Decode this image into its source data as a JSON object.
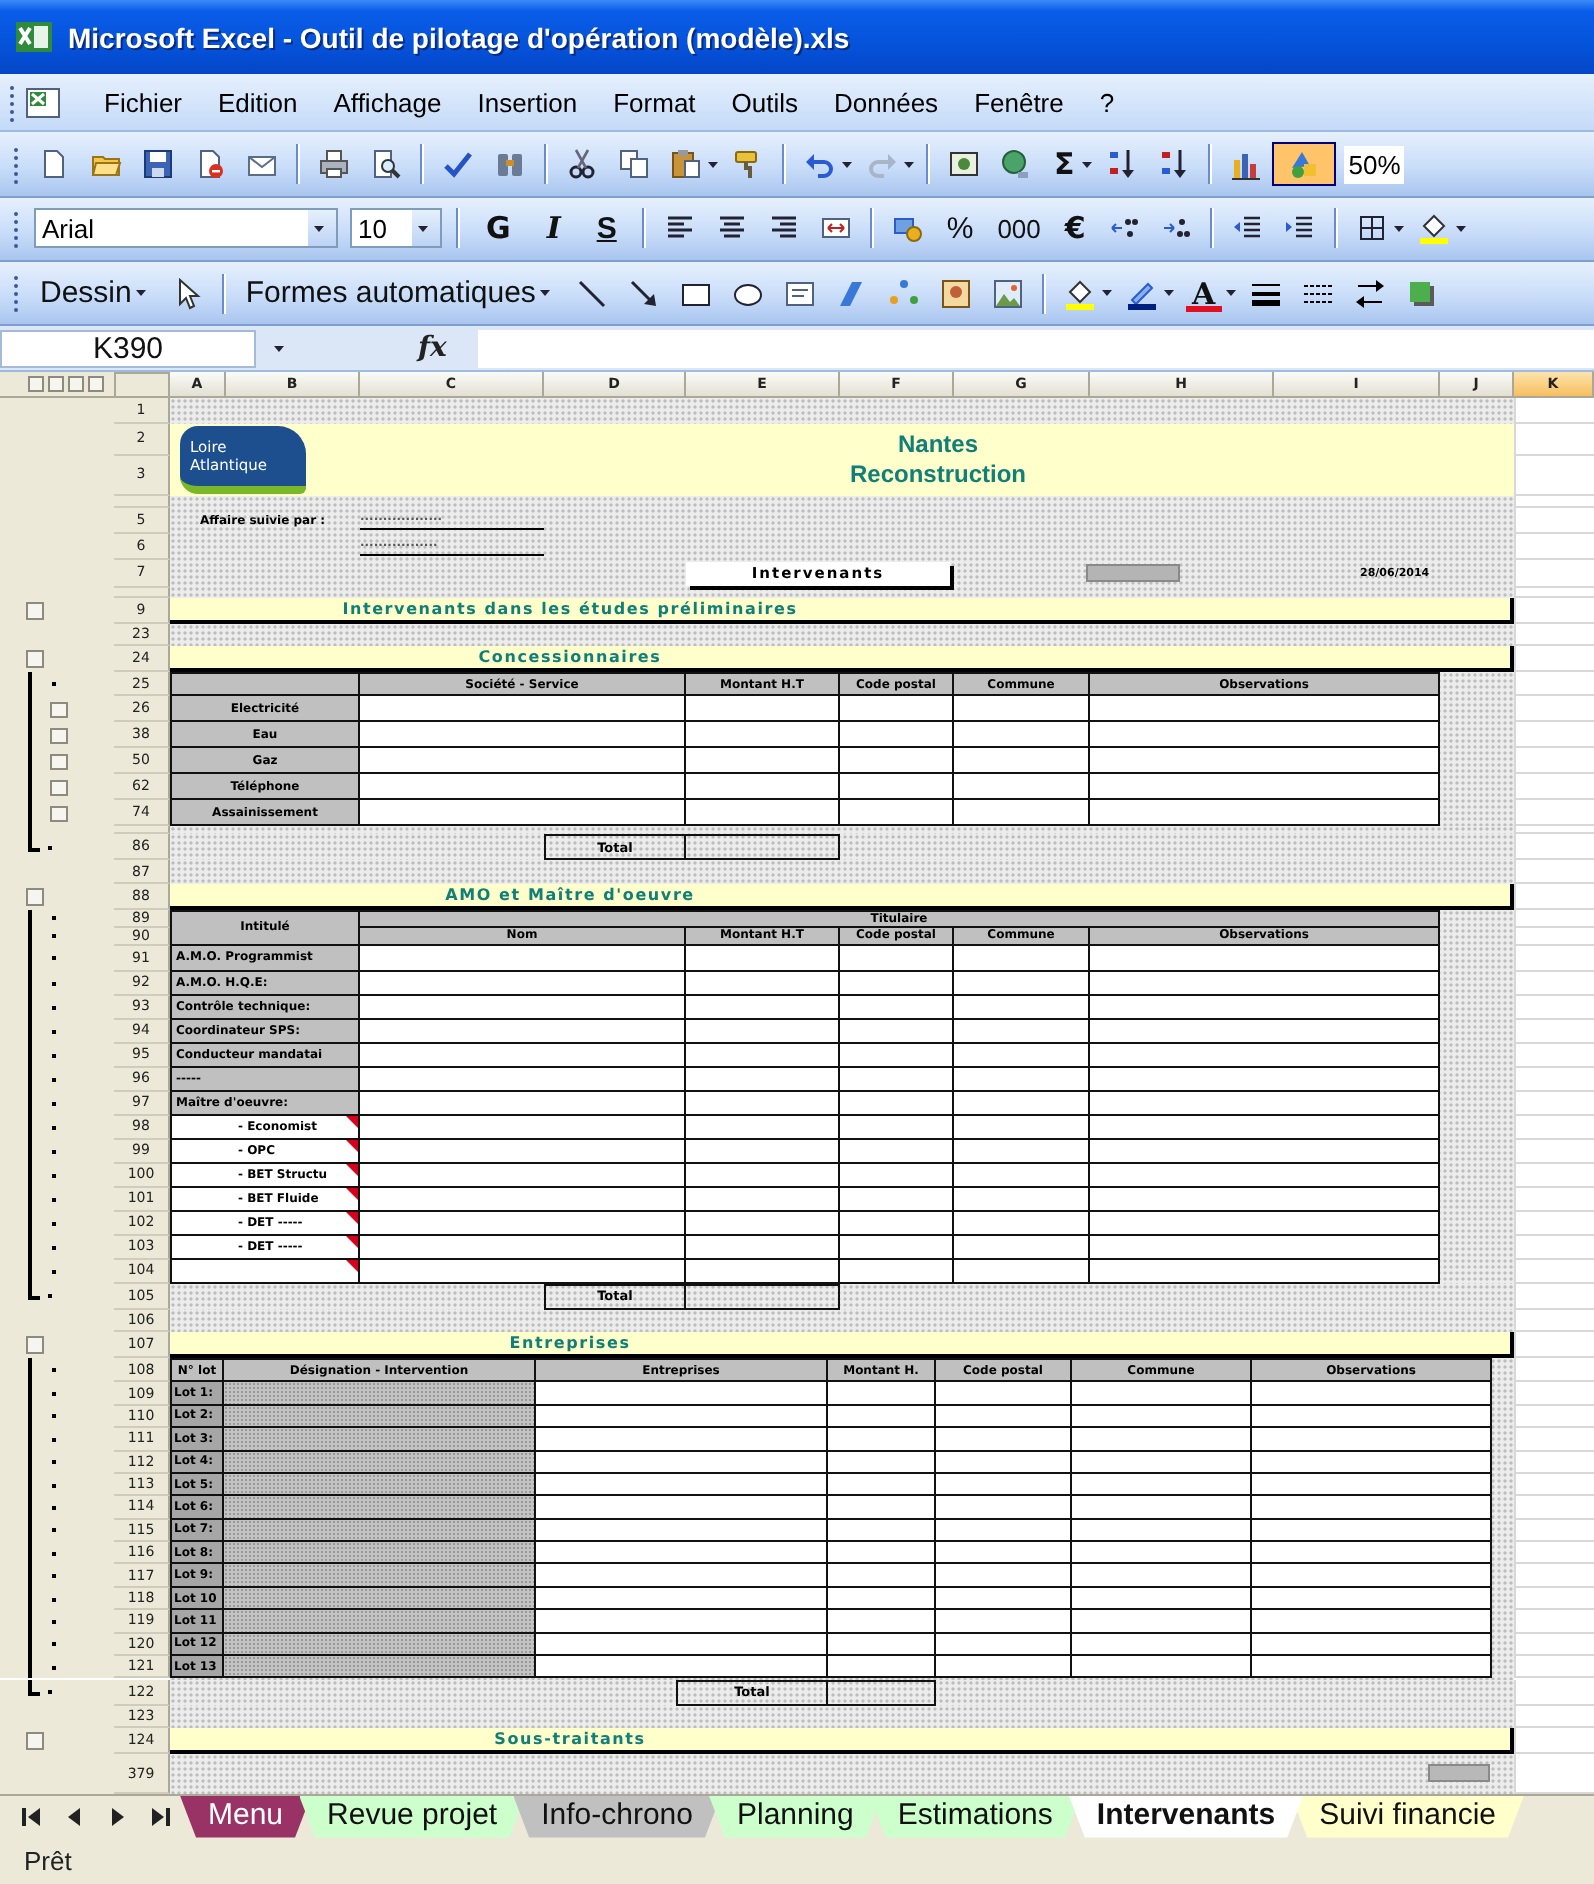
{
  "window": {
    "title": "Microsoft Excel - Outil de pilotage d'opération (modèle).xls"
  },
  "menu": [
    "Fichier",
    "Edition",
    "Affichage",
    "Insertion",
    "Format",
    "Outils",
    "Données",
    "Fenêtre",
    "?"
  ],
  "standard_toolbar": {
    "sum": "Σ",
    "drawing_on": true,
    "zoom": "50%"
  },
  "formatting_toolbar": {
    "font": "Arial",
    "size": "10",
    "bold": "G",
    "italic": "I",
    "underline": "S",
    "percent": "%",
    "thousands": "000",
    "euro": "€"
  },
  "drawing_toolbar": {
    "draw_menu": "Dessin",
    "autoshapes": "Formes automatiques",
    "font_color": "A"
  },
  "formula_bar": {
    "name_box": "K390",
    "function_label": "fx"
  },
  "sheet": {
    "columns": [
      {
        "label": "A",
        "selected": false
      },
      {
        "label": "B",
        "selected": false
      },
      {
        "label": "C",
        "selected": false
      },
      {
        "label": "D",
        "selected": false
      },
      {
        "label": "E",
        "selected": false
      },
      {
        "label": "F",
        "selected": false
      },
      {
        "label": "G",
        "selected": false
      },
      {
        "label": "H",
        "selected": false
      },
      {
        "label": "I",
        "selected": false
      },
      {
        "label": "J",
        "selected": false
      },
      {
        "label": "K",
        "selected": true
      }
    ],
    "bands": [
      {
        "kind": "banner",
        "rows": [
          {
            "number": "1",
            "kind": "plain"
          },
          {
            "number": "2",
            "kind": "plain"
          },
          {
            "number": "3",
            "kind": "plain"
          }
        ],
        "logo": [
          "Loire",
          "Atlantique"
        ],
        "title": "Nantes",
        "subtitle": "Reconstruction"
      },
      {
        "kind": "info",
        "rows": [
          {
            "kind": "plain"
          },
          {
            "number": "5",
            "kind": "plain"
          },
          {
            "number": "6",
            "kind": "plain"
          },
          {
            "number": "7",
            "kind": "plain"
          },
          {
            "kind": "plain"
          }
        ],
        "label": "Affaire suivie par :",
        "followers": [
          "..................",
          "................."
        ],
        "button": "Intervenants",
        "date": "28/06/2014"
      },
      {
        "kind": "section",
        "rows": [
          {
            "number": "9",
            "kind": "button"
          }
        ],
        "title": "Intervenants dans les études préliminaires"
      },
      {
        "kind": "blank",
        "rows": [
          {
            "number": "23",
            "kind": "plain"
          }
        ]
      },
      {
        "kind": "section",
        "rows": [
          {
            "number": "24",
            "kind": "button"
          }
        ],
        "title": "Concessionnaires"
      },
      {
        "kind": "utility_table",
        "header_rows": [
          {
            "number": "25",
            "kind": "dot"
          }
        ],
        "columns": [
          "Société - Service",
          "Montant H.T",
          "Code postal",
          "Commune",
          "Observations"
        ],
        "rows": [
          {
            "number": "26",
            "kind": "subbutton",
            "label": "Electricité"
          },
          {
            "number": "38",
            "kind": "subbutton",
            "label": "Eau"
          },
          {
            "number": "50",
            "kind": "subbutton",
            "label": "Gaz"
          },
          {
            "number": "62",
            "kind": "subbutton",
            "label": "Téléphone"
          },
          {
            "number": "74",
            "kind": "subbutton",
            "label": "Assainissement"
          }
        ]
      },
      {
        "kind": "thin",
        "rows": [
          {
            "kind": "line"
          }
        ]
      },
      {
        "kind": "total",
        "rows": [
          {
            "number": "86",
            "kind": "end"
          }
        ],
        "label": "Total"
      },
      {
        "kind": "blank",
        "rows": [
          {
            "number": "87",
            "kind": "plain"
          }
        ]
      },
      {
        "kind": "section",
        "rows": [
          {
            "number": "88",
            "kind": "button"
          }
        ],
        "title": "AMO et Maître d'oeuvre"
      },
      {
        "kind": "team_table",
        "corner": "Intitulé",
        "group": "Titulaire",
        "header_rows": [
          {
            "number": "89",
            "kind": "dot"
          },
          {
            "number": "90",
            "kind": "dot"
          }
        ],
        "columns": [
          "Nom",
          "Montant H.T",
          "Code postal",
          "Commune",
          "Observations"
        ],
        "rows": [
          {
            "number": "91",
            "kind": "dot",
            "shaded": true,
            "label": "A.M.O. Programmist",
            "comment": false
          },
          {
            "number": "92",
            "kind": "dot",
            "shaded": true,
            "label": "A.M.O. H.Q.E:",
            "comment": false
          },
          {
            "number": "93",
            "kind": "dot",
            "shaded": true,
            "label": "Contrôle technique:",
            "comment": false
          },
          {
            "number": "94",
            "kind": "dot",
            "shaded": true,
            "label": "Coordinateur SPS:",
            "comment": false
          },
          {
            "number": "95",
            "kind": "dot",
            "shaded": true,
            "label": "Conducteur mandatai",
            "comment": false
          },
          {
            "number": "96",
            "kind": "dot",
            "shaded": true,
            "label": "-----",
            "comment": false
          },
          {
            "number": "97",
            "kind": "dot",
            "shaded": true,
            "label": "Maître d'oeuvre:",
            "comment": false
          },
          {
            "number": "98",
            "kind": "dot",
            "shaded": false,
            "label": "- Economist",
            "comment": true
          },
          {
            "number": "99",
            "kind": "dot",
            "shaded": false,
            "label": "- OPC",
            "comment": true
          },
          {
            "number": "100",
            "kind": "dot",
            "shaded": false,
            "label": "- BET Structu",
            "comment": true
          },
          {
            "number": "101",
            "kind": "dot",
            "shaded": false,
            "label": "- BET Fluide",
            "comment": true
          },
          {
            "number": "102",
            "kind": "dot",
            "shaded": false,
            "label": "- DET -----",
            "comment": true
          },
          {
            "number": "103",
            "kind": "dot",
            "shaded": false,
            "label": "- DET -----",
            "comment": true
          },
          {
            "number": "104",
            "kind": "dot",
            "shaded": false,
            "comment": true
          }
        ]
      },
      {
        "kind": "total",
        "rows": [
          {
            "number": "105",
            "kind": "end"
          }
        ],
        "label": "Total"
      },
      {
        "kind": "blank",
        "rows": [
          {
            "number": "106",
            "kind": "plain"
          }
        ]
      },
      {
        "kind": "section",
        "rows": [
          {
            "number": "107",
            "kind": "button"
          }
        ],
        "title": "Entreprises"
      },
      {
        "kind": "lot_table",
        "header_rows": [
          {
            "number": "108",
            "kind": "dot"
          }
        ],
        "columns": [
          "N° lot",
          "Désignation - Intervention",
          "Entreprises",
          "Montant H.",
          "Code postal",
          "Commune",
          "Observations"
        ],
        "rows": [
          {
            "number": "109",
            "kind": "dot",
            "label": "Lot 1:"
          },
          {
            "number": "110",
            "kind": "dot",
            "label": "Lot 2:"
          },
          {
            "number": "111",
            "kind": "dot",
            "label": "Lot 3:"
          },
          {
            "number": "112",
            "kind": "dot",
            "label": "Lot 4:"
          },
          {
            "number": "113",
            "kind": "dot",
            "label": "Lot 5:"
          },
          {
            "number": "114",
            "kind": "dot",
            "label": "Lot 6:"
          },
          {
            "number": "115",
            "kind": "dot",
            "label": "Lot 7:"
          },
          {
            "number": "116",
            "kind": "dot",
            "label": "Lot 8:"
          },
          {
            "number": "117",
            "kind": "dot",
            "label": "Lot 9:"
          },
          {
            "number": "118",
            "kind": "dot",
            "label": "Lot 10"
          },
          {
            "number": "119",
            "kind": "dot",
            "label": "Lot 11"
          },
          {
            "number": "120",
            "kind": "dot",
            "label": "Lot 12"
          },
          {
            "number": "121",
            "kind": "dot",
            "label": "Lot 13"
          }
        ]
      },
      {
        "kind": "lot_total",
        "rows": [
          {
            "number": "122",
            "kind": "end"
          }
        ],
        "label": "Total"
      },
      {
        "kind": "blank",
        "rows": [
          {
            "number": "123",
            "kind": "plain"
          }
        ]
      },
      {
        "kind": "section",
        "rows": [
          {
            "number": "124",
            "kind": "button"
          }
        ],
        "title": "Sous-traitants"
      },
      {
        "kind": "end",
        "rows": [
          {
            "number": "379",
            "kind": "plain"
          }
        ]
      }
    ]
  },
  "sheet_tabs": [
    {
      "label": "Menu",
      "color": "#993366",
      "selected": false
    },
    {
      "label": "Revue projet",
      "color": "#ccffcc",
      "selected": false
    },
    {
      "label": "Info-chrono",
      "color": "#c0c0c0",
      "selected": false
    },
    {
      "label": "Planning",
      "color": "#ccffcc",
      "selected": false
    },
    {
      "label": "Estimations",
      "color": "#ccffcc",
      "selected": false
    },
    {
      "label": "Intervenants",
      "color": "#ffffff",
      "selected": true
    },
    {
      "label": "Suivi financie",
      "color": "#ffffcc",
      "selected": false
    }
  ],
  "status_bar": "Prêt"
}
